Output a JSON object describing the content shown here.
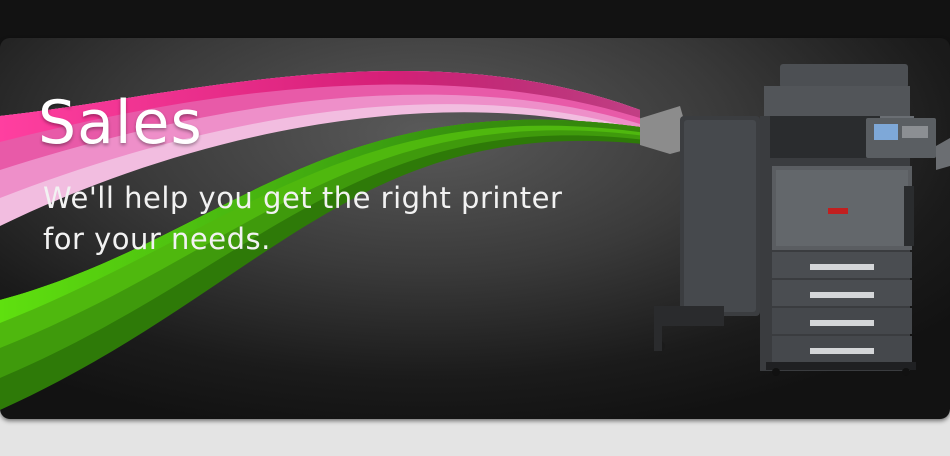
{
  "banner": {
    "title": "Sales",
    "subtitle": "We'll help you get the right printer for your needs."
  },
  "colors": {
    "pink": "#e8298a",
    "green": "#4cc20f",
    "background": "#2e2e2e"
  },
  "icons": {
    "product": "printer-copier-image"
  }
}
